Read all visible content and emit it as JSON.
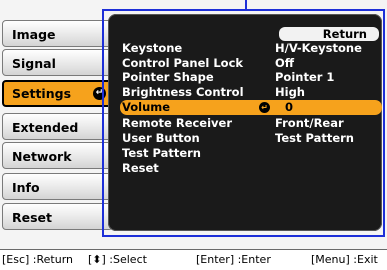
{
  "tabs": [
    {
      "label": "Image"
    },
    {
      "label": "Signal"
    },
    {
      "label": "Settings",
      "active": true
    },
    {
      "label": "Extended"
    },
    {
      "label": "Network"
    },
    {
      "label": "Info"
    },
    {
      "label": "Reset"
    }
  ],
  "panel": {
    "return_label": "Return",
    "items": [
      {
        "label": "Keystone",
        "value": "H/V-Keystone"
      },
      {
        "label": "Control Panel Lock",
        "value": "Off"
      },
      {
        "label": "Pointer Shape",
        "value": "Pointer 1"
      },
      {
        "label": "Brightness Control",
        "value": "High"
      },
      {
        "label": "Volume",
        "value": "0",
        "selected": true
      },
      {
        "label": "Remote Receiver",
        "value": "Front/Rear"
      },
      {
        "label": "User Button",
        "value": "Test Pattern"
      },
      {
        "label": "Test Pattern",
        "value": ""
      },
      {
        "label": "Reset",
        "value": ""
      }
    ]
  },
  "statusbar": {
    "esc": "[Esc] :Return",
    "select": "[⬍] :Select",
    "enter": "[Enter] :Enter",
    "menu": "[Menu] :Exit"
  },
  "colors": {
    "accent": "#f6a21c",
    "outline": "#1d2fd8",
    "panel": "#1a1a1a"
  },
  "icons": {
    "enter": "enter-icon",
    "selected_item": "enter-icon"
  }
}
